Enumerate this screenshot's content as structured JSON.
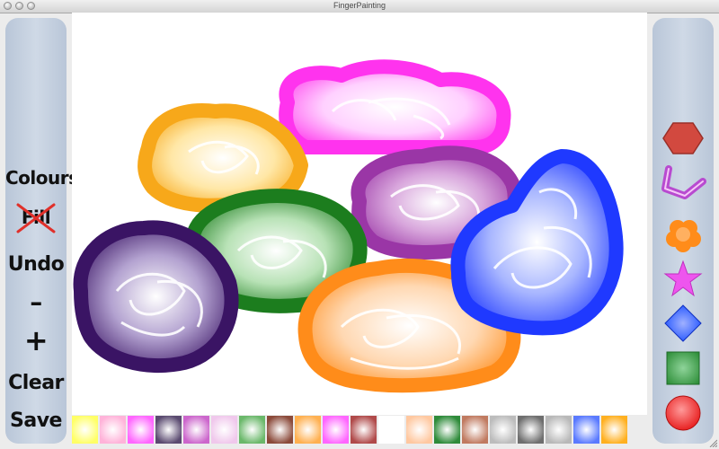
{
  "window": {
    "title": "FingerPainting"
  },
  "tools": {
    "colours": "Colours",
    "fill": "Fill",
    "undo": "Undo",
    "minus": "–",
    "plus": "+",
    "clear": "Clear",
    "save": "Save"
  },
  "palette": [
    "#ffff66",
    "#ffb3d9",
    "#ff66ff",
    "#5a4a70",
    "#cc66cc",
    "#f0c8ec",
    "#6ab86a",
    "#8b4a3a",
    "#ffb050",
    "#ff66ff",
    "#b04a4a",
    "#ffffff",
    "#ffc8a0",
    "#2e8b3a",
    "#c07a60",
    "#bcbcbc",
    "#6e6e6e",
    "#b8b8b8",
    "#5a7aff",
    "#ffb020"
  ],
  "shapes": [
    "hexagon-icon",
    "zigzag-arrow-icon",
    "flower-icon",
    "star-icon",
    "diamond-icon",
    "square-icon",
    "circle-icon"
  ],
  "colors": {
    "hexagon": "#d2493f",
    "zigzag": "#b84ad0",
    "flower": "#ff8c1a",
    "star": "#ee55ee",
    "diamond": "#1a4fff",
    "square": "#2f8f3a",
    "circle": "#e82222"
  }
}
